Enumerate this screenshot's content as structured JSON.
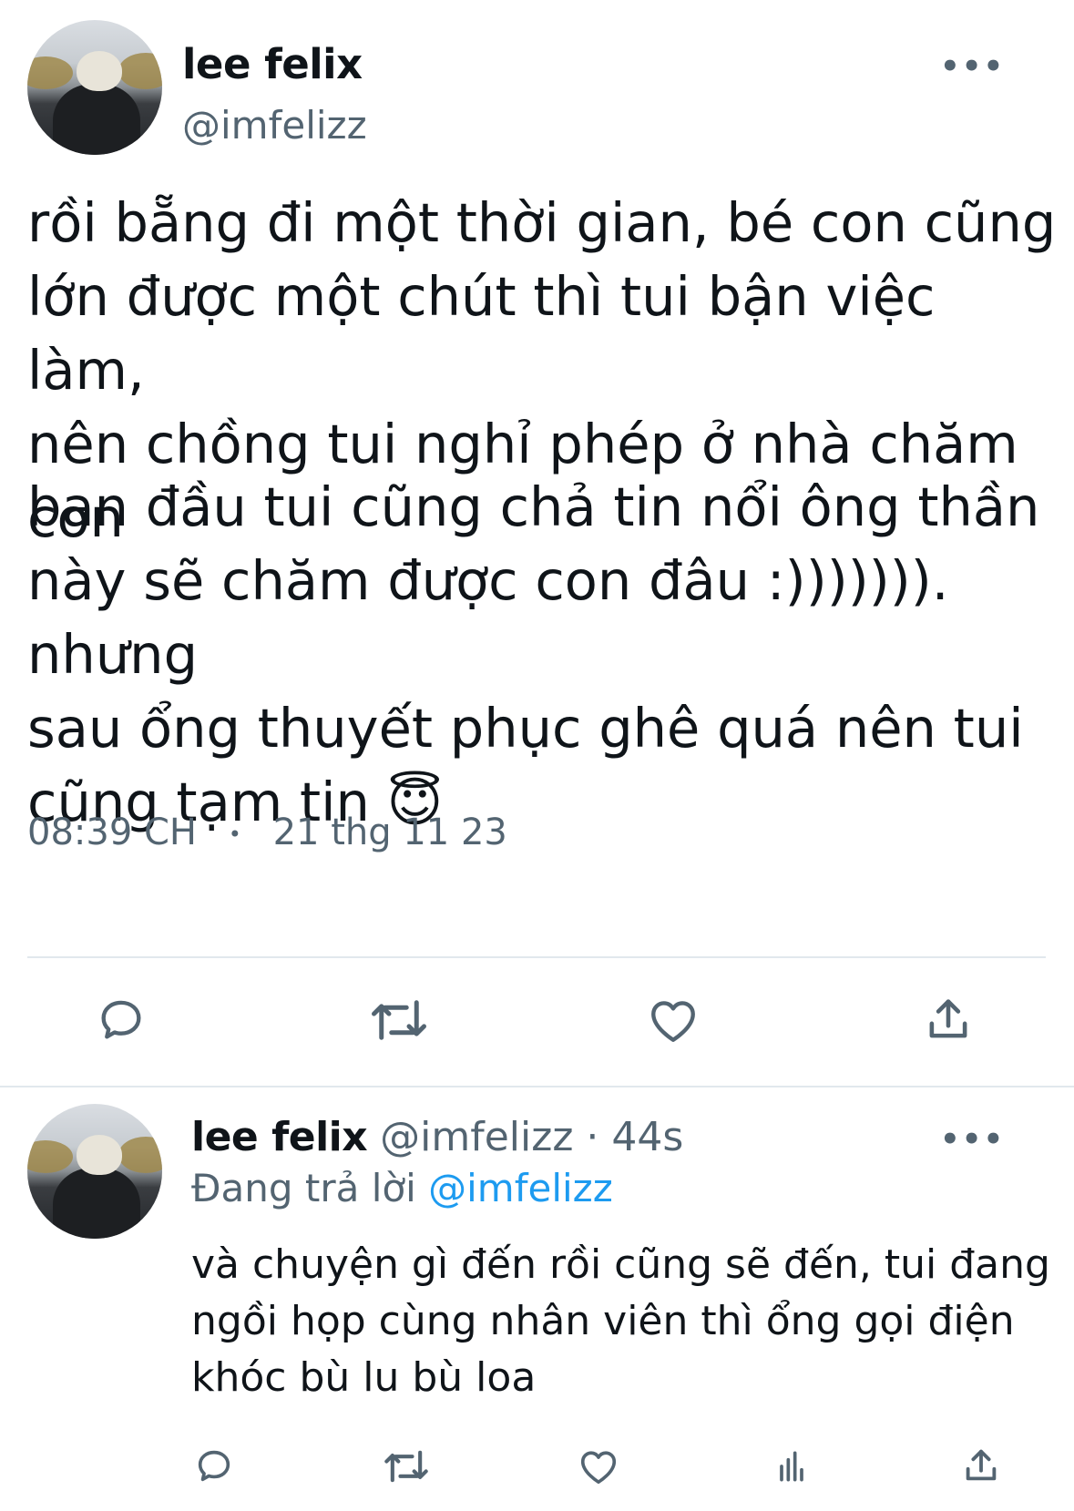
{
  "main_tweet": {
    "display_name": "lee felix",
    "handle": "@imfelizz",
    "more_label": "•••",
    "paragraph_1": "rồi bẵng đi một thời gian, bé con cũng\nlớn được một chút thì tui bận việc làm,\nnên chồng tui nghỉ phép ở nhà chăm con",
    "paragraph_2": "ban đầu tui cũng chả tin nổi ông thần\nnày sẽ chăm được con đâu :))))))). nhưng\nsau ổng thuyết phục ghê quá nên tui\ncũng tạm tin",
    "emoji": "😇",
    "time": "08:39 CH",
    "separator": "•",
    "date": "21 thg 11 23",
    "actions": [
      "reply-icon",
      "retweet-icon",
      "like-icon",
      "share-icon"
    ]
  },
  "reply_tweet": {
    "display_name": "lee felix",
    "handle": "@imfelizz",
    "age": "· 44s",
    "more_label": "•••",
    "replying_to_label": "Đang trả lời",
    "replying_to_handle": "@imfelizz",
    "text_line_1": "và chuyện gì đến rồi cũng sẽ đến, tui đang",
    "text_line_2": "ngồi họp cùng nhân viên thì ổng gọi điện",
    "text_line_3": "khóc bù lu bù loa",
    "actions": [
      "reply-icon",
      "retweet-icon",
      "like-icon",
      "analytics-icon",
      "share-icon"
    ]
  },
  "colors": {
    "text": "#0f1419",
    "secondary": "#536471",
    "link": "#1d9bf0",
    "divider": "#e1e8ed"
  }
}
